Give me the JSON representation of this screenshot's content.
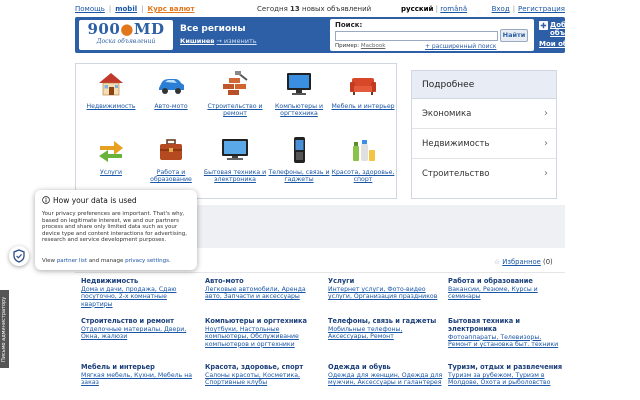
{
  "topbar": {
    "help": "Помощь",
    "mobil": "mobil",
    "currency": "Курс валют",
    "today_prefix": "Сегодня",
    "today_count": "13",
    "today_suffix": "новых объявлений",
    "lang_ru": "русский",
    "lang_ro": "română",
    "login": "Вход",
    "register": "Регистрация"
  },
  "header": {
    "logo_main": "900",
    "logo_dot": "●",
    "logo_md": "MD",
    "logo_sub": "Доска объявлений",
    "regions_title": "Все регионы",
    "region_current": "Кишинев",
    "region_change": "→ изменить",
    "search_label": "Поиск:",
    "search_value": "",
    "search_button": "Найти",
    "example_label": "Пример:",
    "example_value": "Macbook",
    "advanced_search": "+ расширенный поиск",
    "add_ad": "Добавить объявление",
    "my_ads": "Мои объявления"
  },
  "categories": [
    {
      "label": "Недвижимость",
      "icon": "house-icon"
    },
    {
      "label": "Авто-мото",
      "icon": "car-icon"
    },
    {
      "label": "Строительство и ремонт",
      "icon": "bricks-icon"
    },
    {
      "label": "Компьютеры и оргтехника",
      "icon": "monitor-icon"
    },
    {
      "label": "Мебель и интерьер",
      "icon": "sofa-icon"
    },
    {
      "label": "Услуги",
      "icon": "arrows-icon"
    },
    {
      "label": "Работа и образование",
      "icon": "briefcase-icon"
    },
    {
      "label": "Бытовая техника и электроника",
      "icon": "tv-icon"
    },
    {
      "label": "Телефоны, связь и гаджеты",
      "icon": "phone-icon"
    },
    {
      "label": "Красота, здоровье, спорт",
      "icon": "cosmetics-icon"
    }
  ],
  "right_panel": {
    "header": "Подробнее",
    "items": [
      "Экономика",
      "Недвижимость",
      "Строительство"
    ]
  },
  "favorites": {
    "label": "Избранное",
    "count": "(0)"
  },
  "sections": [
    {
      "title": "Недвижимость",
      "desc": "Дома и дачи, продажа, Сдаю посуточно, 2-х комнатные квартиры"
    },
    {
      "title": "Авто-мото",
      "desc": "Легковые автомобили, Аренда авто, Запчасти и аксессуары"
    },
    {
      "title": "Услуги",
      "desc": "Интернет услуги, Фото-видео услуги, Организация праздников"
    },
    {
      "title": "Работа и образование",
      "desc": "Вакансии, Резюме, Курсы и семинары"
    },
    {
      "title": "Строительство и ремонт",
      "desc": "Отделочные материалы, Двери, Окна, жалюзи"
    },
    {
      "title": "Компьютеры и оргтехника",
      "desc": "Ноутбуки, Настольные компьютеры, Обслуживание компьютеров и оргтехники"
    },
    {
      "title": "Телефоны, связь и гаджеты",
      "desc": "Мобильные телефоны, Аксессуары, Ремонт"
    },
    {
      "title": "Бытовая техника и электроника",
      "desc": "Фотоаппараты, Телевизоры, Ремонт и установка быт. техники"
    },
    {
      "title": "Мебель и интерьер",
      "desc": "Мягкая мебель, Кухни, Мебель на заказ"
    },
    {
      "title": "Красота, здоровье, спорт",
      "desc": "Салоны красоты, Косметика, Спортивные клубы"
    },
    {
      "title": "Одежда и обувь",
      "desc": "Одежда для женщин, Одежда для мужчин, Аксессуары и галантерея"
    },
    {
      "title": "Туризм, отдых и развлечения",
      "desc": "Туризм за рубежом, Туризм в Молдове, Охота и рыболовство"
    }
  ],
  "cookie_popup": {
    "title": "How your data is used",
    "body": "Your privacy preferences are important. That's why, based on legitimate interest, we and our partners process and share only limited data such as your device type and content interactions for advertising, research and service development purposes.",
    "foot_prefix": "View",
    "partner_list": "partner list",
    "foot_mid": "and manage",
    "privacy_settings": "privacy settings",
    "foot_end": "."
  },
  "side_tab": "Письмо администратору",
  "colors": {
    "brand_blue": "#2c5fa6",
    "link_blue": "#1a56a6",
    "accent_orange": "#e2761b"
  }
}
